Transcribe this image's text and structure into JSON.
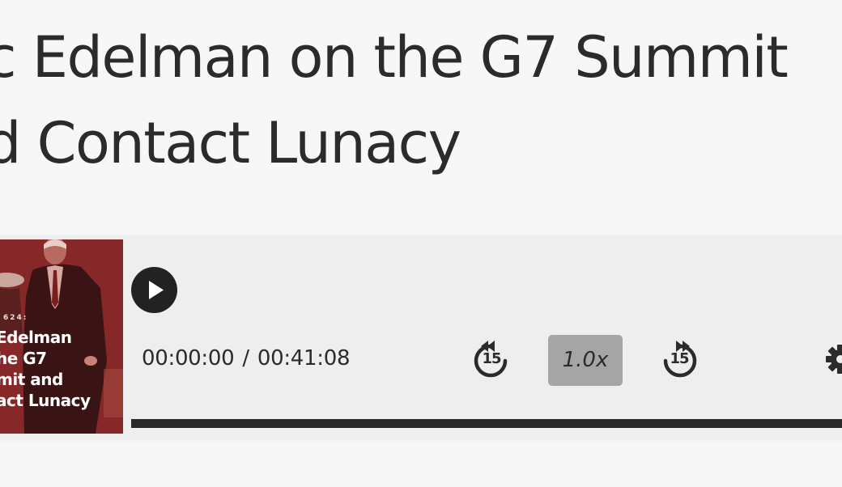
{
  "episode": {
    "title_line1": "c Edelman on the G7 Summit",
    "title_line2": "d Contact Lunacy"
  },
  "cover": {
    "episode_number": "624:",
    "lines": [
      "Edelman",
      "he G7",
      "mit and",
      "act Lunacy"
    ],
    "background_color": "#8e2b2b"
  },
  "player": {
    "current_time": "00:00:00",
    "separator": "/",
    "duration": "00:41:08",
    "skip_back_seconds": "15",
    "skip_forward_seconds": "15",
    "speed_label": "1.0x",
    "progress_fraction": 0,
    "icons": {
      "play": "play-icon",
      "skip_back": "rewind-15-icon",
      "skip_forward": "forward-15-icon",
      "settings": "gear-icon"
    },
    "colors": {
      "dark": "#222222",
      "speed_bg": "#a5a5a5",
      "panel_bg": "#eeeeee"
    }
  }
}
